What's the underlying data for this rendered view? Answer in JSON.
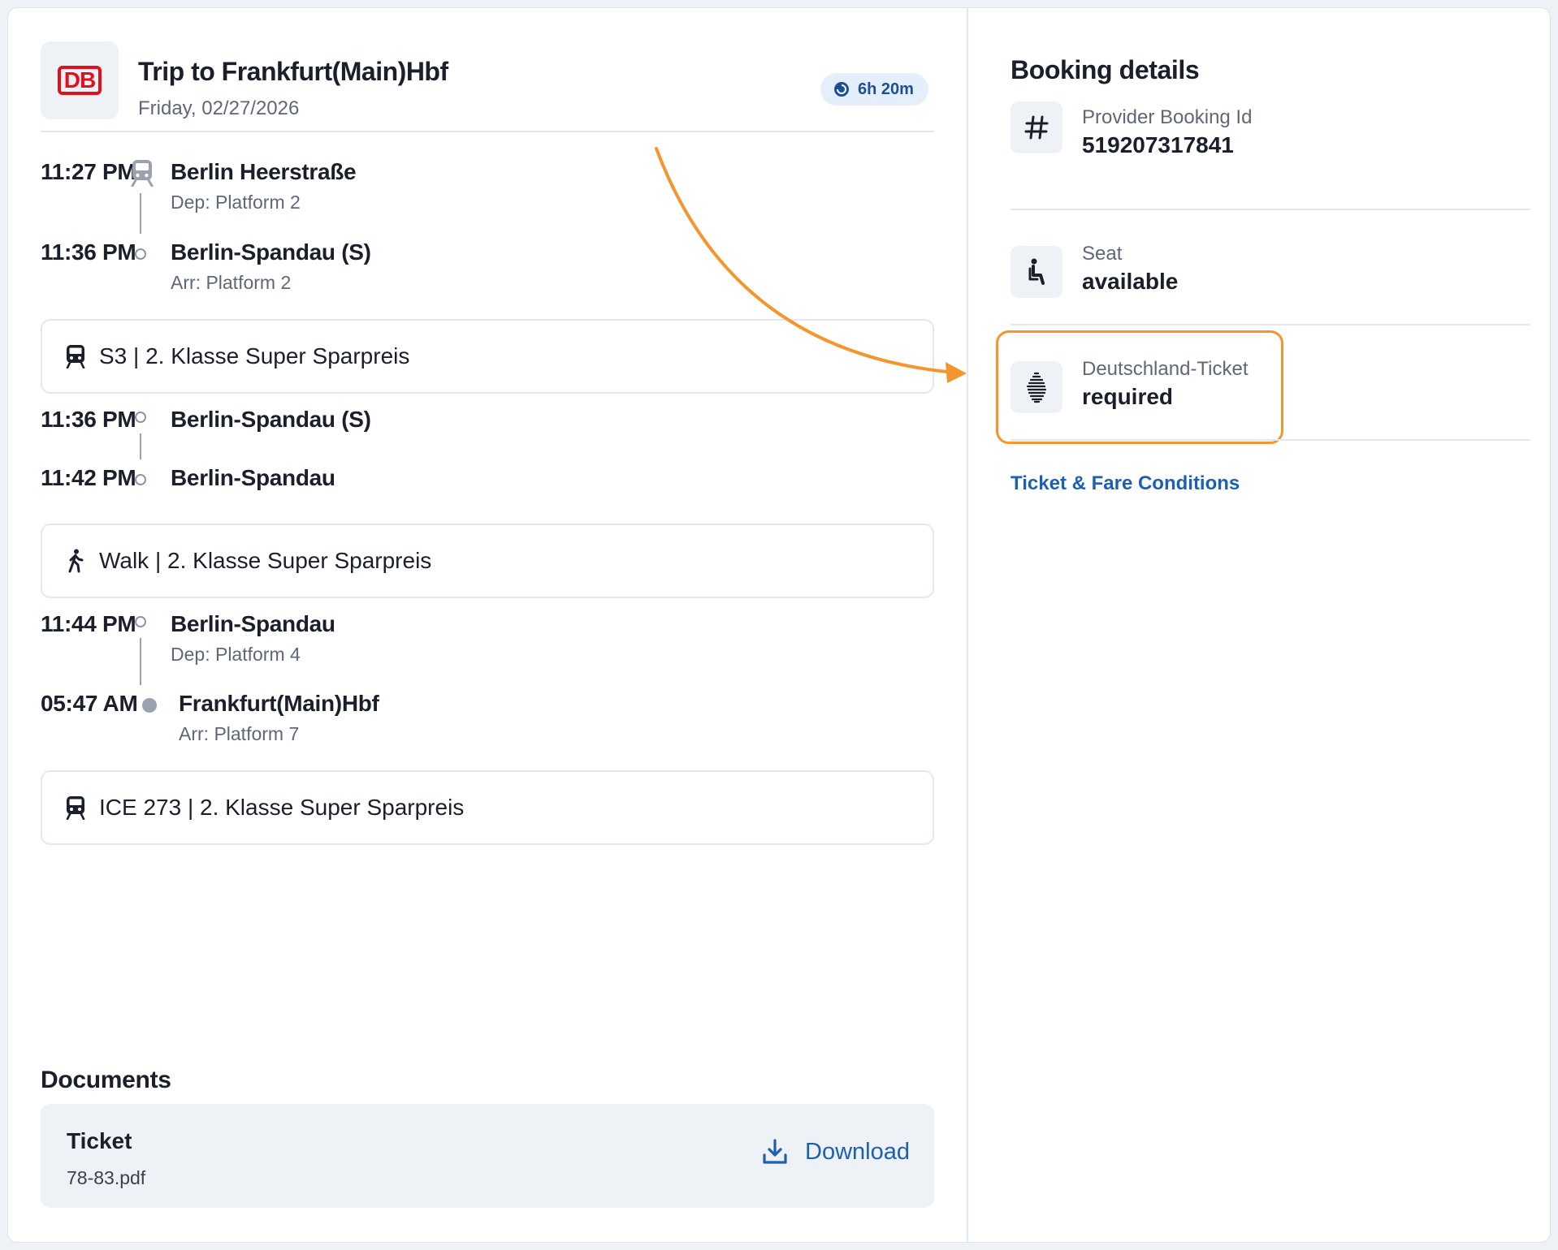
{
  "trip": {
    "title": "Trip to Frankfurt(Main)Hbf",
    "date": "Friday, 02/27/2026",
    "duration": "6h 20m",
    "logo_text": "DB"
  },
  "legs": [
    {
      "dep_time": "11:27 PM",
      "dep_station": "Berlin Heerstraße",
      "dep_platform": "Dep: Platform 2",
      "arr_time": "11:36 PM",
      "arr_station": "Berlin-Spandau (S)",
      "arr_platform": "Arr: Platform 2",
      "segment": "S3 | 2. Klasse Super Sparpreis"
    },
    {
      "dep_time": "11:36 PM",
      "dep_station": "Berlin-Spandau (S)",
      "arr_time": "11:42 PM",
      "arr_station": "Berlin-Spandau",
      "segment": "Walk | 2. Klasse Super Sparpreis"
    },
    {
      "dep_time": "11:44 PM",
      "dep_station": "Berlin-Spandau",
      "dep_platform": "Dep: Platform 4",
      "arr_time": "05:47 AM",
      "arr_station": "Frankfurt(Main)Hbf",
      "arr_platform": "Arr: Platform 7",
      "segment": "ICE 273 | 2. Klasse Super Sparpreis"
    }
  ],
  "documents": {
    "title": "Documents",
    "items": [
      {
        "name": "Ticket",
        "file": "78-83.pdf",
        "action": "Download"
      }
    ]
  },
  "booking": {
    "title": "Booking details",
    "items": [
      {
        "label": "Provider Booking Id",
        "value": "519207317841",
        "icon": "hash-icon"
      },
      {
        "label": "Seat",
        "value": "available",
        "icon": "seat-icon"
      },
      {
        "label": "Deutschland-Ticket",
        "value": "required",
        "icon": "germany-map-icon"
      }
    ],
    "link": "Ticket & Fare Conditions"
  },
  "colors": {
    "accent_blue": "#1d5fb0",
    "db_red": "#e3101b",
    "highlight_orange": "#f5952f",
    "badge_bg": "#e5eefb"
  }
}
